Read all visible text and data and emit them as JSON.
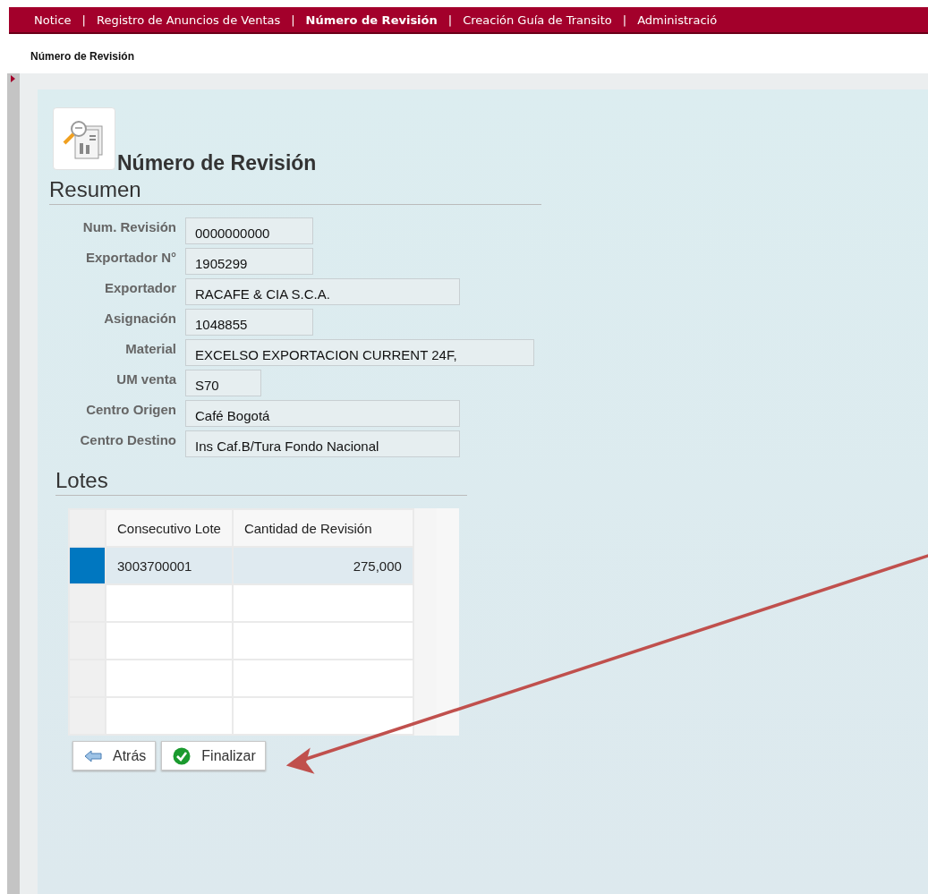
{
  "nav": [
    {
      "kind": "tab",
      "label": "Notice",
      "selected": false
    },
    {
      "kind": "separator",
      "label": "|"
    },
    {
      "kind": "tab",
      "label": "Registro de Anuncios de Ventas",
      "selected": false
    },
    {
      "kind": "separator",
      "label": "|"
    },
    {
      "kind": "tab",
      "label": "Número de Revisión",
      "selected": true
    },
    {
      "kind": "separator",
      "label": "|"
    },
    {
      "kind": "tab",
      "label": "Creación Guía de Transito",
      "selected": false
    },
    {
      "kind": "separator",
      "label": "|"
    },
    {
      "kind": "tab",
      "label": "Administració",
      "selected": false
    }
  ],
  "page_title": "Número de Revisión",
  "heading": "Número de Revisión",
  "summary": {
    "title": "Resumen",
    "fields": [
      {
        "label": "Num. Revisión",
        "value": "0000000000",
        "kind": "medium"
      },
      {
        "label": "Exportador N°",
        "value": "1905299",
        "kind": "medium"
      },
      {
        "label": "Exportador",
        "value": "RACAFE & CIA S.C.A.",
        "kind": "long"
      },
      {
        "label": "Asignación",
        "value": "1048855",
        "kind": "medium"
      },
      {
        "label": "Material",
        "value": "EXCELSO EXPORTACION CURRENT 24F,",
        "kind": "xlong"
      },
      {
        "label": "UM venta",
        "value": "S70",
        "kind": "short"
      },
      {
        "label": "Centro Origen",
        "value": "Café Bogotá",
        "kind": "long"
      },
      {
        "label": "Centro Destino",
        "value": "Ins Caf.B/Tura Fondo Nacional",
        "kind": "long"
      }
    ]
  },
  "lots": {
    "title": "Lotes",
    "table": {
      "columns": [
        "Consecutivo Lote",
        "Cantidad de Revisión"
      ],
      "rows": [
        {
          "selected": true,
          "cells": [
            "3003700001",
            "275,000"
          ]
        },
        {
          "selected": false
        },
        {
          "selected": false
        },
        {
          "selected": false
        },
        {
          "selected": false
        }
      ]
    }
  },
  "buttons": [
    {
      "label": "Atrás",
      "kind": "back"
    },
    {
      "label": "Finalizar",
      "kind": "finish"
    }
  ]
}
